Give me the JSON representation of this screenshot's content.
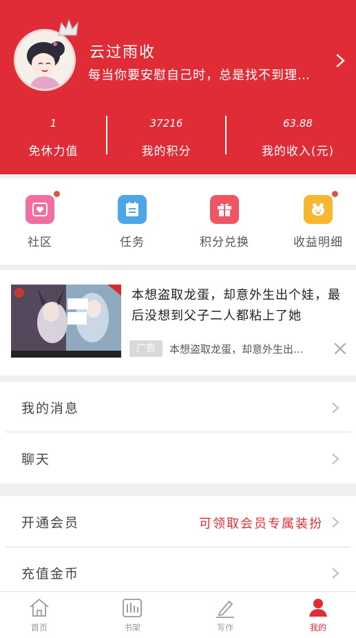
{
  "profile": {
    "username": "云过雨收",
    "signature": "每当你要安慰自己时，总是找不到理…"
  },
  "stats": [
    {
      "value": "1",
      "label": "免休力值"
    },
    {
      "value": "37216",
      "label": "我的积分"
    },
    {
      "value": "63.88",
      "label": "我的收入(元)"
    }
  ],
  "grid": [
    {
      "label": "社区",
      "icon": "heart-envelope-icon",
      "color": "#f06fa0",
      "badge": true
    },
    {
      "label": "任务",
      "icon": "task-list-icon",
      "color": "#4da6e8",
      "badge": false
    },
    {
      "label": "积分兑换",
      "icon": "gift-icon",
      "color": "#ef5563",
      "badge": false
    },
    {
      "label": "收益明细",
      "icon": "piggy-icon",
      "color": "#f7b731",
      "badge": true
    }
  ],
  "ad": {
    "title": "本想盗取龙蛋，却意外生出个娃，最后没想到父子二人都粘上了她",
    "badge": "广告",
    "desc": "本想盗取龙蛋，却意外生出…"
  },
  "menu1": [
    {
      "label": "我的消息"
    },
    {
      "label": "聊天"
    }
  ],
  "menu2": [
    {
      "label": "开通会员",
      "extra": "可领取会员专属装扮"
    },
    {
      "label": "充值金币",
      "extra": ""
    }
  ],
  "tabs": [
    {
      "label": "首页",
      "icon": "home-icon"
    },
    {
      "label": "书架",
      "icon": "bookshelf-icon"
    },
    {
      "label": "写作",
      "icon": "pen-icon"
    },
    {
      "label": "我的",
      "icon": "user-icon"
    }
  ],
  "colors": {
    "brand": "#e02c37"
  }
}
